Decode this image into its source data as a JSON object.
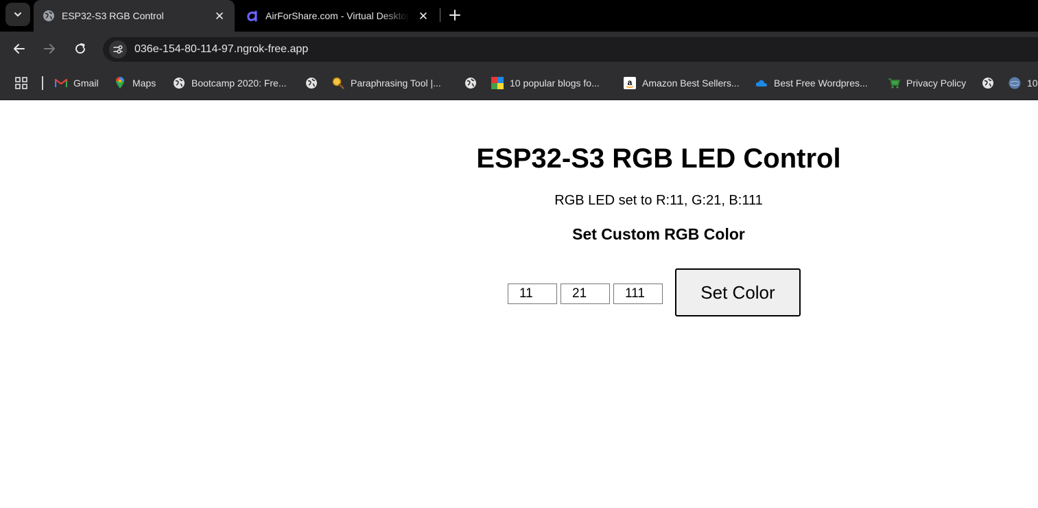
{
  "browser": {
    "tabs": [
      {
        "title": "ESP32-S3 RGB Control",
        "active": true,
        "icon": "globe-icon"
      },
      {
        "title": "AirForShare.com - Virtual Desktop",
        "active": false,
        "icon": "airforshare-icon"
      }
    ],
    "url": "036e-154-80-114-97.ngrok-free.app",
    "bookmarks": [
      {
        "label": "Gmail",
        "icon": "gmail-icon"
      },
      {
        "label": "Maps",
        "icon": "maps-icon"
      },
      {
        "label": "Bootcamp 2020: Fre...",
        "icon": "globe-icon"
      },
      {
        "label": "",
        "icon": "globe-icon"
      },
      {
        "label": "Paraphrasing Tool |...",
        "icon": "magnifier-icon"
      },
      {
        "label": "",
        "icon": "globe-icon"
      },
      {
        "label": "10 popular blogs fo...",
        "icon": "blog-icon"
      },
      {
        "label": "Amazon Best Sellers...",
        "icon": "amazon-icon"
      },
      {
        "label": "Best Free Wordpres...",
        "icon": "cloud-icon"
      },
      {
        "label": "Privacy Policy",
        "icon": "cart-icon"
      },
      {
        "label": "",
        "icon": "globe-icon"
      },
      {
        "label": "10",
        "icon": "site-icon"
      }
    ]
  },
  "page": {
    "title": "ESP32-S3 RGB LED Control",
    "status": "RGB LED set to R:11, G:21, B:111",
    "form_heading": "Set Custom RGB Color",
    "inputs": {
      "r": "11",
      "g": "21",
      "b": "111"
    },
    "submit_label": "Set Color"
  }
}
